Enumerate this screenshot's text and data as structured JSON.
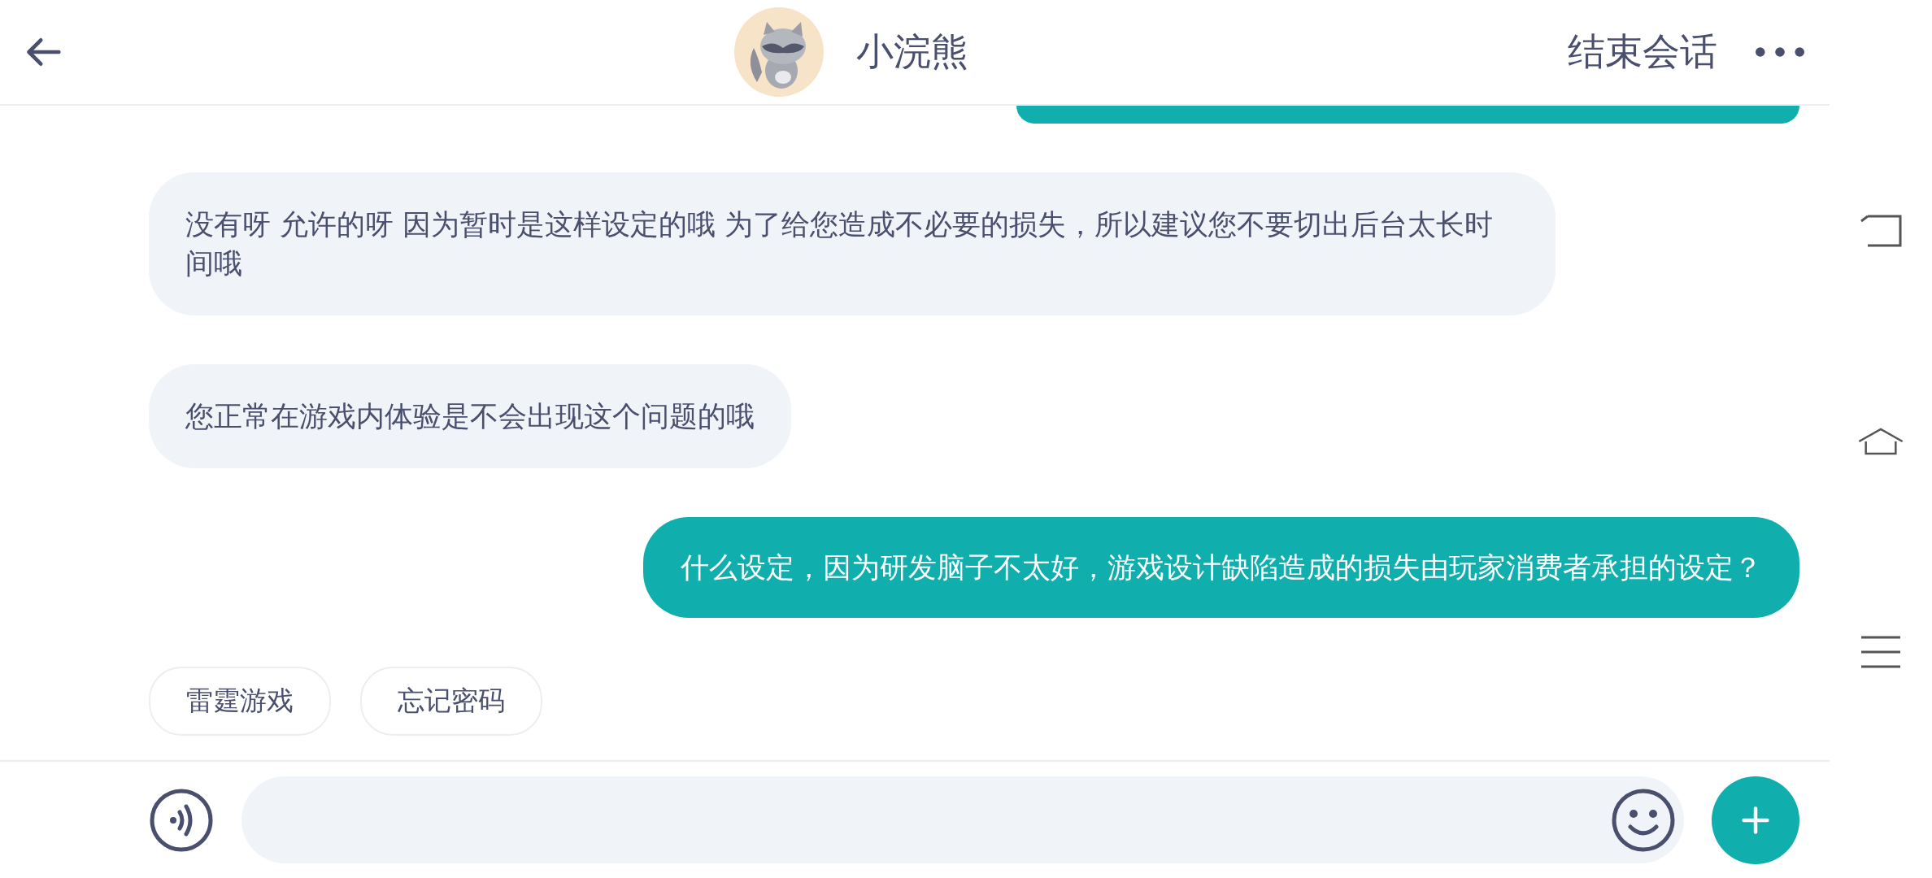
{
  "header": {
    "title": "小浣熊",
    "end_button": "结束会话"
  },
  "messages": [
    {
      "kind": "incoming",
      "text": "没有呀 允许的呀 因为暂时是这样设定的哦 为了给您造成不必要的损失，所以建议您不要切出后台太长时间哦"
    },
    {
      "kind": "incoming",
      "text": "您正常在游戏内体验是不会出现这个问题的哦"
    },
    {
      "kind": "outgoing",
      "text": "什么设定，因为研发脑子不太好，游戏设计缺陷造成的损失由玩家消费者承担的设定？"
    }
  ],
  "quick_replies": [
    "雷霆游戏",
    "忘记密码"
  ]
}
